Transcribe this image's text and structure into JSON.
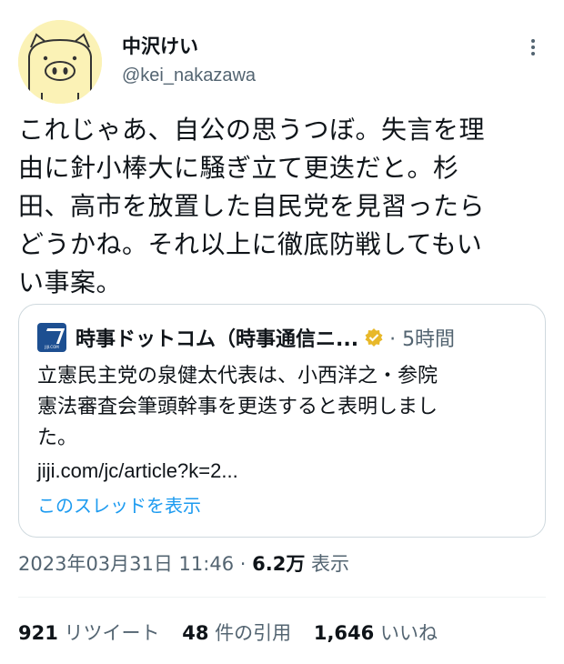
{
  "author": {
    "display_name": "中沢けい",
    "handle": "@kei_nakazawa",
    "avatar_icon": "pig-avatar-icon"
  },
  "tweet": {
    "line1": "これじゃあ、自公の思うつぼ。失言を理",
    "line2": "由に針小棒大に騒ぎ立て更迭だと。杉",
    "line3": "田、高市を放置した自民党を見習ったら",
    "line4": "どうかね。それ以上に徹底防戦してもい",
    "line5": "い事案。"
  },
  "quote": {
    "source_name": "時事ドットコム（時事通信ニ...",
    "logo_text": "JIJI.COM",
    "verified_icon": "verified-badge-icon",
    "time": "· 5時間",
    "body_line1": "立憲民主党の泉健太代表は、小西洋之・参院",
    "body_line2": "憲法審査会筆頭幹事を更迭すると表明しまし",
    "body_line3": "た。",
    "link": "jiji.com/jc/article?k=2...",
    "thread_link": "このスレッドを表示"
  },
  "meta": {
    "timestamp": "2023年03月31日 11:46 ·",
    "views_count": "6.2万",
    "views_label": "表示"
  },
  "stats": {
    "retweets_count": "921",
    "retweets_label": "リツイート",
    "quotes_count": "48",
    "quotes_label": "件の引用",
    "likes_count": "1,646",
    "likes_label": "いいね"
  },
  "colors": {
    "text": "#0f1419",
    "secondary": "#536471",
    "link": "#1d9bf0",
    "avatar_bg": "#fbf2b6",
    "verified_gold": "#e8b829",
    "border": "#cfd9de"
  }
}
